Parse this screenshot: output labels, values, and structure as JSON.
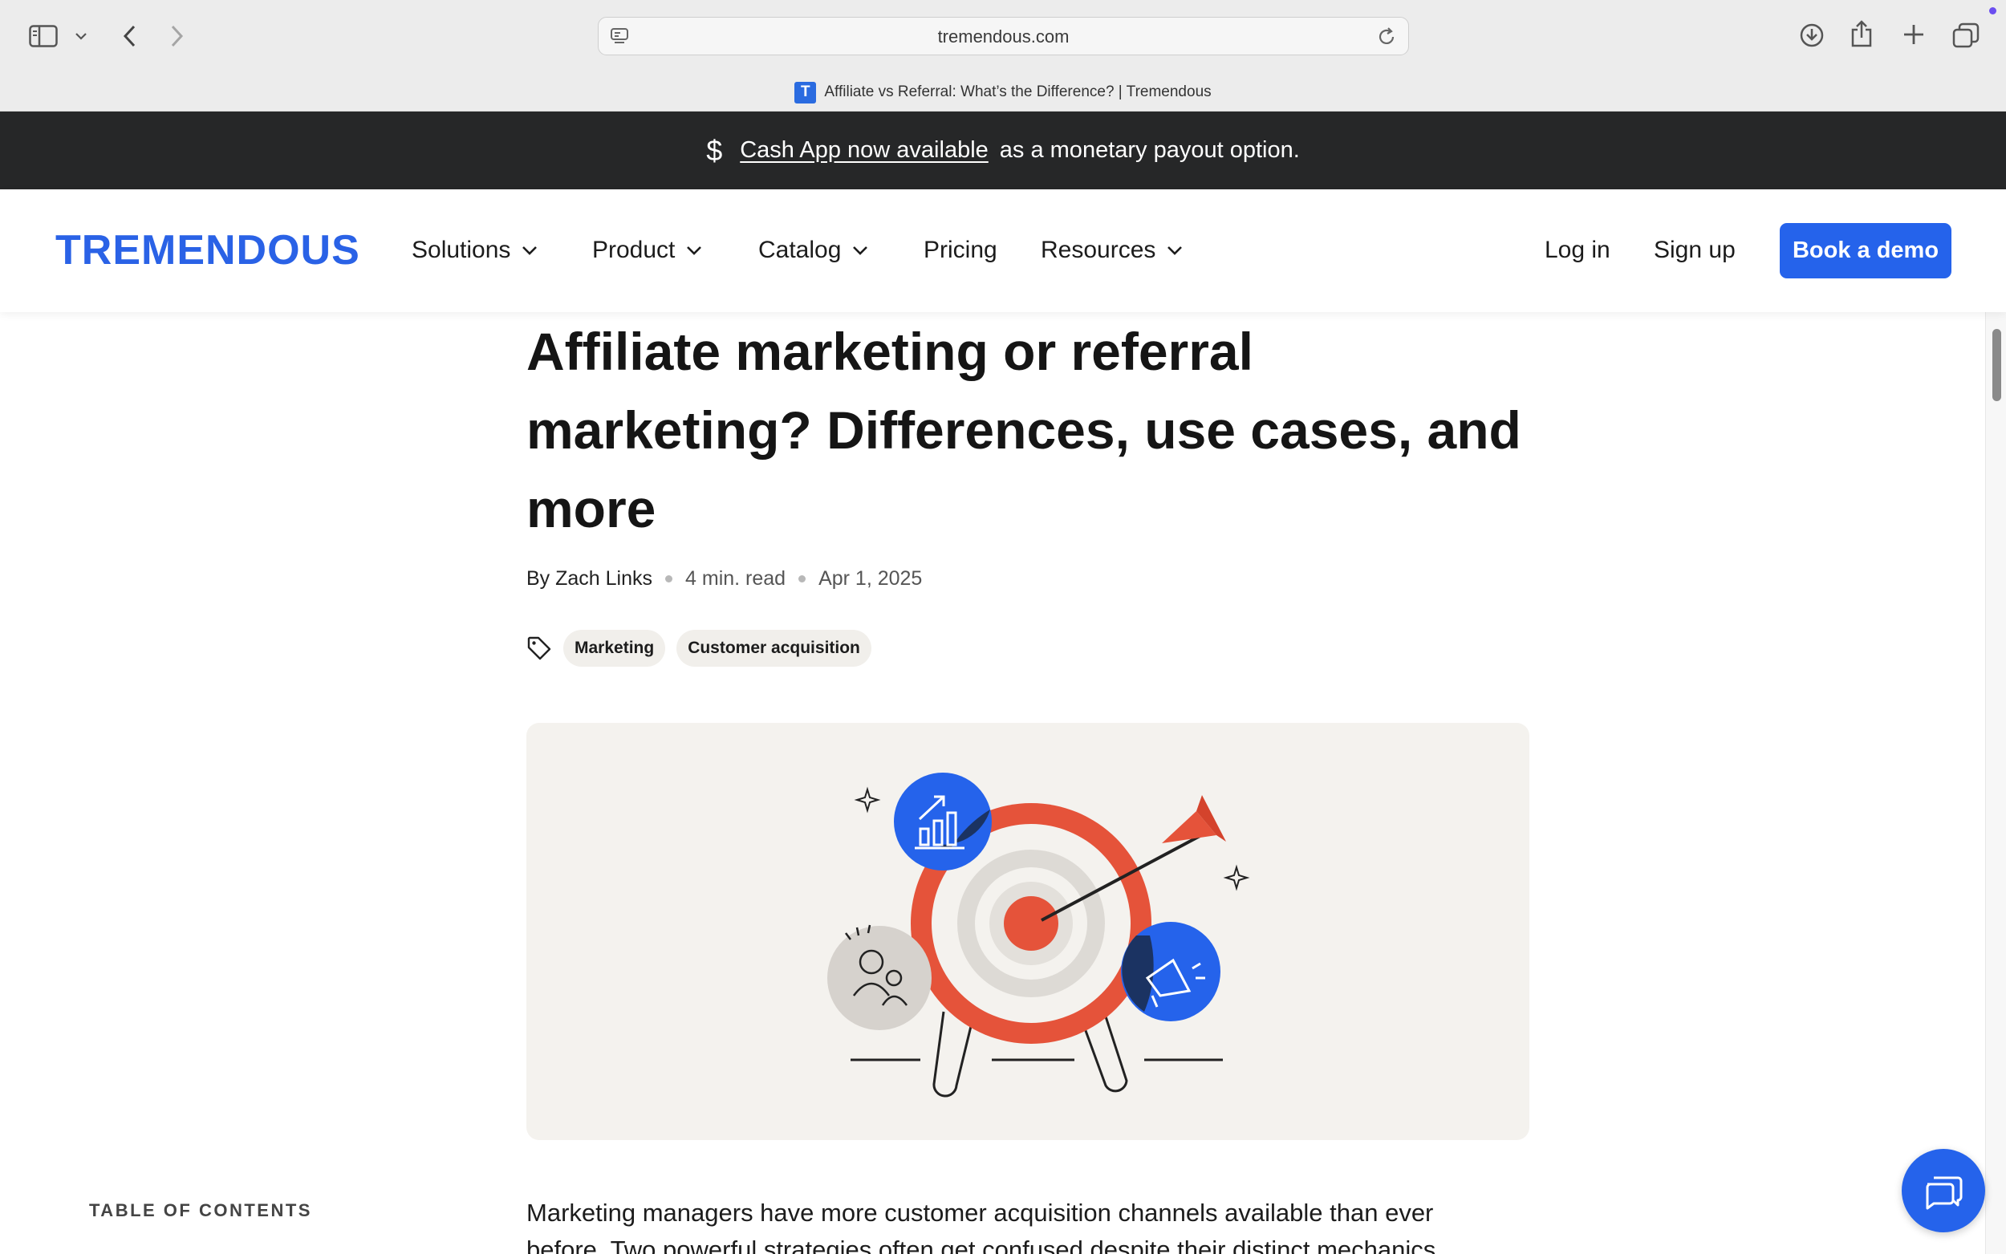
{
  "browser": {
    "url": "tremendous.com",
    "tab_title": "Affiliate vs Referral: What’s the Difference? | Tremendous",
    "favicon_letter": "T"
  },
  "banner": {
    "icon": "dollar-icon",
    "link_text": "Cash App now available",
    "rest_text": "as a monetary payout option."
  },
  "nav": {
    "logo": "TREMENDOUS",
    "items": [
      {
        "label": "Solutions",
        "has_dropdown": true
      },
      {
        "label": "Product",
        "has_dropdown": true
      },
      {
        "label": "Catalog",
        "has_dropdown": true
      },
      {
        "label": "Pricing",
        "has_dropdown": false
      },
      {
        "label": "Resources",
        "has_dropdown": true
      }
    ],
    "login": "Log in",
    "signup": "Sign up",
    "demo": "Book a demo"
  },
  "article": {
    "title_lines": [
      "Affiliate marketing or referral",
      "marketing? Differences, use cases, and",
      "more"
    ],
    "author": "By Zach Links",
    "read_time": "4 min. read",
    "date": "Apr 1, 2025",
    "tags": [
      "Marketing",
      "Customer acquisition"
    ],
    "toc_heading": "TABLE OF CONTENTS",
    "intro_line1": "Marketing managers have more customer acquisition channels available than ever",
    "intro_line2": "before. Two powerful strategies often get confused despite their distinct mechanics"
  },
  "colors": {
    "brand_blue": "#2563eb",
    "target_red": "#e5533a",
    "banner_bg": "#262728"
  }
}
